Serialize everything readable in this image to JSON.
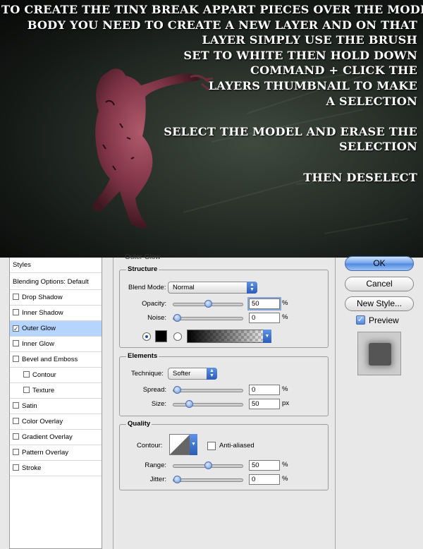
{
  "instructions": {
    "lines": [
      "TO CREATE THE TINY BREAK APPART PIECES OVER THE MODELS",
      "BODY YOU NEED TO CREATE A NEW LAYER AND ON THAT",
      "LAYER SIMPLY USE THE BRUSH",
      "SET TO WHITE THEN HOLD DOWN",
      "COMMAND + CLICK THE",
      "LAYERS THUMBNAIL TO MAKE",
      "A SELECTION",
      "",
      "SELECT THE MODEL AND ERASE THE",
      "SELECTION",
      "",
      "THEN DESELECT"
    ]
  },
  "styles_panel": {
    "items": [
      {
        "label": "Styles",
        "checkbox": false,
        "checked": false,
        "selected": false,
        "indent": false
      },
      {
        "label": "Blending Options: Default",
        "checkbox": false,
        "checked": false,
        "selected": false,
        "indent": false
      },
      {
        "label": "Drop Shadow",
        "checkbox": true,
        "checked": false,
        "selected": false,
        "indent": false
      },
      {
        "label": "Inner Shadow",
        "checkbox": true,
        "checked": false,
        "selected": false,
        "indent": false
      },
      {
        "label": "Outer Glow",
        "checkbox": true,
        "checked": true,
        "selected": true,
        "indent": false
      },
      {
        "label": "Inner Glow",
        "checkbox": true,
        "checked": false,
        "selected": false,
        "indent": false
      },
      {
        "label": "Bevel and Emboss",
        "checkbox": true,
        "checked": false,
        "selected": false,
        "indent": false
      },
      {
        "label": "Contour",
        "checkbox": true,
        "checked": false,
        "selected": false,
        "indent": true
      },
      {
        "label": "Texture",
        "checkbox": true,
        "checked": false,
        "selected": false,
        "indent": true
      },
      {
        "label": "Satin",
        "checkbox": true,
        "checked": false,
        "selected": false,
        "indent": false
      },
      {
        "label": "Color Overlay",
        "checkbox": true,
        "checked": false,
        "selected": false,
        "indent": false
      },
      {
        "label": "Gradient Overlay",
        "checkbox": true,
        "checked": false,
        "selected": false,
        "indent": false
      },
      {
        "label": "Pattern Overlay",
        "checkbox": true,
        "checked": false,
        "selected": false,
        "indent": false
      },
      {
        "label": "Stroke",
        "checkbox": true,
        "checked": false,
        "selected": false,
        "indent": false
      }
    ]
  },
  "outer_glow": {
    "title": "Outer Glow",
    "structure": {
      "heading": "Structure",
      "blend_mode_label": "Blend Mode:",
      "blend_mode_value": "Normal",
      "opacity_label": "Opacity:",
      "opacity_value": "50",
      "opacity_unit": "%",
      "opacity_level": 0.5,
      "noise_label": "Noise:",
      "noise_value": "0",
      "noise_unit": "%",
      "noise_level": 0.0,
      "color_swatch": "#000000"
    },
    "elements": {
      "heading": "Elements",
      "technique_label": "Technique:",
      "technique_value": "Softer",
      "spread_label": "Spread:",
      "spread_value": "0",
      "spread_unit": "%",
      "spread_level": 0.0,
      "size_label": "Size:",
      "size_value": "50",
      "size_unit": "px",
      "size_level": 0.2
    },
    "quality": {
      "heading": "Quality",
      "contour_label": "Contour:",
      "anti_aliased_label": "Anti-aliased",
      "range_label": "Range:",
      "range_value": "50",
      "range_unit": "%",
      "range_level": 0.5,
      "jitter_label": "Jitter:",
      "jitter_value": "0",
      "jitter_unit": "%",
      "jitter_level": 0.0
    }
  },
  "buttons": {
    "ok": "OK",
    "cancel": "Cancel",
    "new_style": "New Style...",
    "preview": "Preview"
  },
  "colors": {
    "accent": "#4f88e0",
    "selection": "#b5d5ff",
    "figure": "#8a3a4c"
  }
}
